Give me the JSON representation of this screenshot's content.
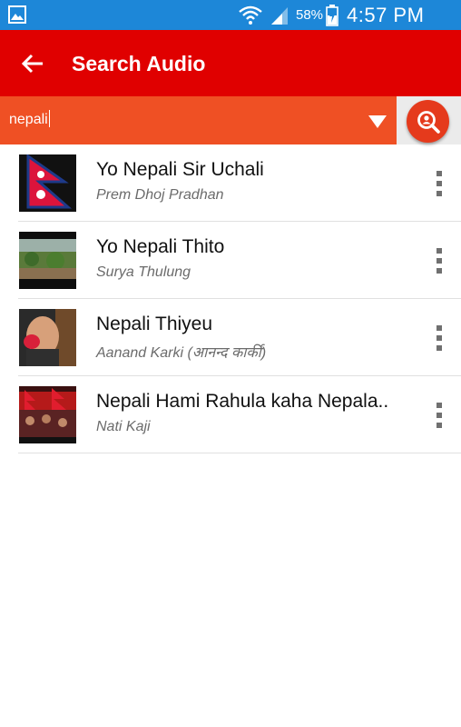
{
  "status_bar": {
    "battery_percent": "58%",
    "time": "4:57 PM",
    "icons": [
      "gallery-icon",
      "wifi-icon",
      "signal-icon",
      "battery-charging-icon"
    ]
  },
  "app_bar": {
    "title": "Search Audio",
    "back_icon": "arrow-left-icon",
    "color": "#e00000"
  },
  "search": {
    "value": "nepali",
    "dropdown_icon": "triangle-down-icon",
    "button_icon": "search-person-icon",
    "field_color": "#ef5024"
  },
  "results": [
    {
      "title": "Yo Nepali Sir Uchali",
      "artist": "Prem Dhoj Pradhan",
      "thumbnail": "nepal-flag-thumbnail"
    },
    {
      "title": "Yo Nepali Thito",
      "artist": "Surya Thulung",
      "thumbnail": "landscape-thumbnail"
    },
    {
      "title": "Nepali Thiyeu",
      "artist": "Aanand Karki (आनन्द कार्की)",
      "thumbnail": "face-thumbnail"
    },
    {
      "title": "Nepali Hami Rahula kaha Nepala..",
      "artist": "Nati Kaji",
      "thumbnail": "crowd-flags-thumbnail"
    }
  ],
  "item_menu_icon": "more-vertical-icon"
}
